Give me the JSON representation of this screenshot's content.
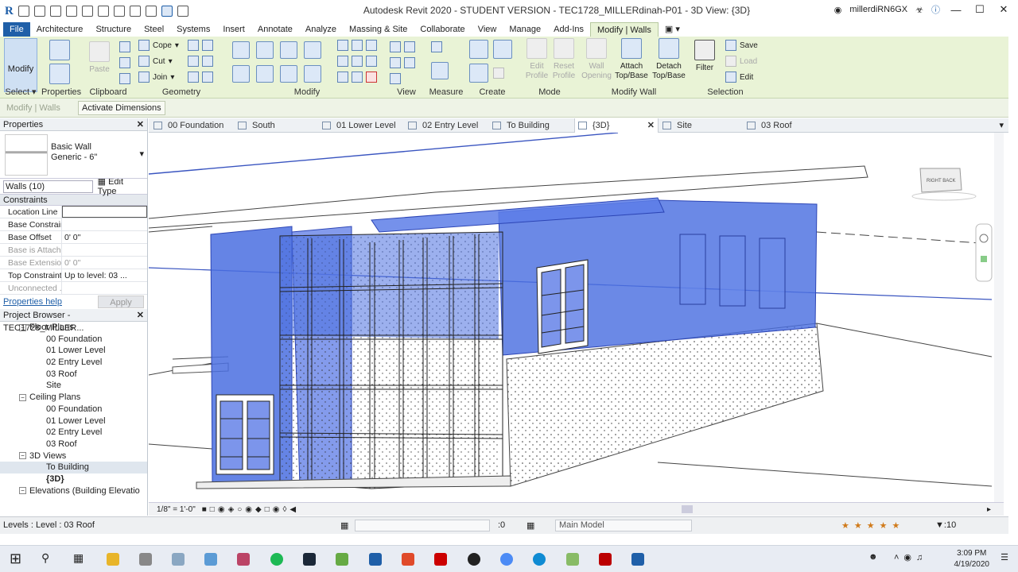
{
  "window": {
    "title": "Autodesk Revit 2020 - STUDENT VERSION - TEC1728_MILLERdinah-P01 - 3D View: {3D}",
    "user": "millerdiRN6GX",
    "app_logo": "R"
  },
  "ribbon_tabs": [
    "File",
    "Architecture",
    "Structure",
    "Steel",
    "Systems",
    "Insert",
    "Annotate",
    "Analyze",
    "Massing & Site",
    "Collaborate",
    "View",
    "Manage",
    "Add-Ins",
    "Modify | Walls"
  ],
  "ribbon": {
    "modify_label": "Modify",
    "paste_label": "Paste",
    "cope_label": "Cope",
    "cut_label": "Cut",
    "join_label": "Join",
    "edit_profile": "Edit\nProfile",
    "reset_profile": "Reset\nProfile",
    "wall_opening": "Wall\nOpening",
    "attach_label": "Attach\nTop/Base",
    "detach_label": "Detach\nTop/Base",
    "filter_label": "Filter",
    "save_label": "Save",
    "load_label": "Load",
    "edit_label": "Edit",
    "panels": [
      "Select",
      "Properties",
      "Clipboard",
      "Geometry",
      "Modify",
      "View",
      "Measure",
      "Create",
      "Mode",
      "Modify Wall",
      "Selection"
    ]
  },
  "options_bar": {
    "context": "Modify | Walls",
    "activate_dimensions": "Activate Dimensions"
  },
  "properties": {
    "title": "Properties",
    "type_family": "Basic Wall",
    "type_name": "Generic - 6\"",
    "selector": "Walls (10)",
    "edit_type": "Edit Type",
    "group": "Constraints",
    "rows": [
      {
        "k": "Location Line",
        "v": "",
        "dim": false
      },
      {
        "k": "Base Constraint",
        "v": "",
        "dim": false
      },
      {
        "k": "Base Offset",
        "v": "0'  0\"",
        "dim": false
      },
      {
        "k": "Base is Attach...",
        "v": "",
        "dim": true
      },
      {
        "k": "Base Extensio...",
        "v": "0'  0\"",
        "dim": true
      },
      {
        "k": "Top Constraint",
        "v": "Up to level: 03 ...",
        "dim": false
      },
      {
        "k": "Unconnected ...",
        "v": "",
        "dim": true
      }
    ],
    "help": "Properties help",
    "apply": "Apply"
  },
  "project_browser": {
    "title": "Project Browser - TEC1728_MILLER...",
    "nodes": [
      {
        "label": "Floor Plans",
        "level": 1,
        "toggle": "-",
        "bold": false,
        "selected": false
      },
      {
        "label": "00 Foundation",
        "level": 2,
        "toggle": "",
        "bold": false,
        "selected": false
      },
      {
        "label": "01 Lower Level",
        "level": 2,
        "toggle": "",
        "bold": false,
        "selected": false
      },
      {
        "label": "02 Entry Level",
        "level": 2,
        "toggle": "",
        "bold": false,
        "selected": false
      },
      {
        "label": "03 Roof",
        "level": 2,
        "toggle": "",
        "bold": false,
        "selected": false
      },
      {
        "label": "Site",
        "level": 2,
        "toggle": "",
        "bold": false,
        "selected": false
      },
      {
        "label": "Ceiling Plans",
        "level": 1,
        "toggle": "-",
        "bold": false,
        "selected": false
      },
      {
        "label": "00 Foundation",
        "level": 2,
        "toggle": "",
        "bold": false,
        "selected": false
      },
      {
        "label": "01 Lower Level",
        "level": 2,
        "toggle": "",
        "bold": false,
        "selected": false
      },
      {
        "label": "02 Entry Level",
        "level": 2,
        "toggle": "",
        "bold": false,
        "selected": false
      },
      {
        "label": "03 Roof",
        "level": 2,
        "toggle": "",
        "bold": false,
        "selected": false
      },
      {
        "label": "3D Views",
        "level": 1,
        "toggle": "-",
        "bold": false,
        "selected": false
      },
      {
        "label": "To Building",
        "level": 2,
        "toggle": "",
        "bold": false,
        "selected": true
      },
      {
        "label": "{3D}",
        "level": 2,
        "toggle": "",
        "bold": true,
        "selected": false
      },
      {
        "label": "Elevations (Building Elevatio",
        "level": 1,
        "toggle": "-",
        "bold": false,
        "selected": false
      }
    ]
  },
  "view_tabs": [
    "00 Foundation",
    "South",
    "01 Lower Level",
    "02 Entry Level",
    "To Building",
    "{3D}",
    "Site",
    "03 Roof"
  ],
  "view_bar": {
    "scale": "1/8\" = 1'-0\""
  },
  "status": {
    "text": "Levels : Level : 03 Roof",
    "workset_value": ":0",
    "model": "Main Model",
    "filter_count": ":10"
  },
  "taskbar": {
    "time": "3:09 PM",
    "date": "4/19/2020"
  },
  "colors": {
    "ribbon_bg": "#e9f3d6",
    "accent": "#1f5fa8",
    "selection_blue": "#4a6fe0"
  }
}
